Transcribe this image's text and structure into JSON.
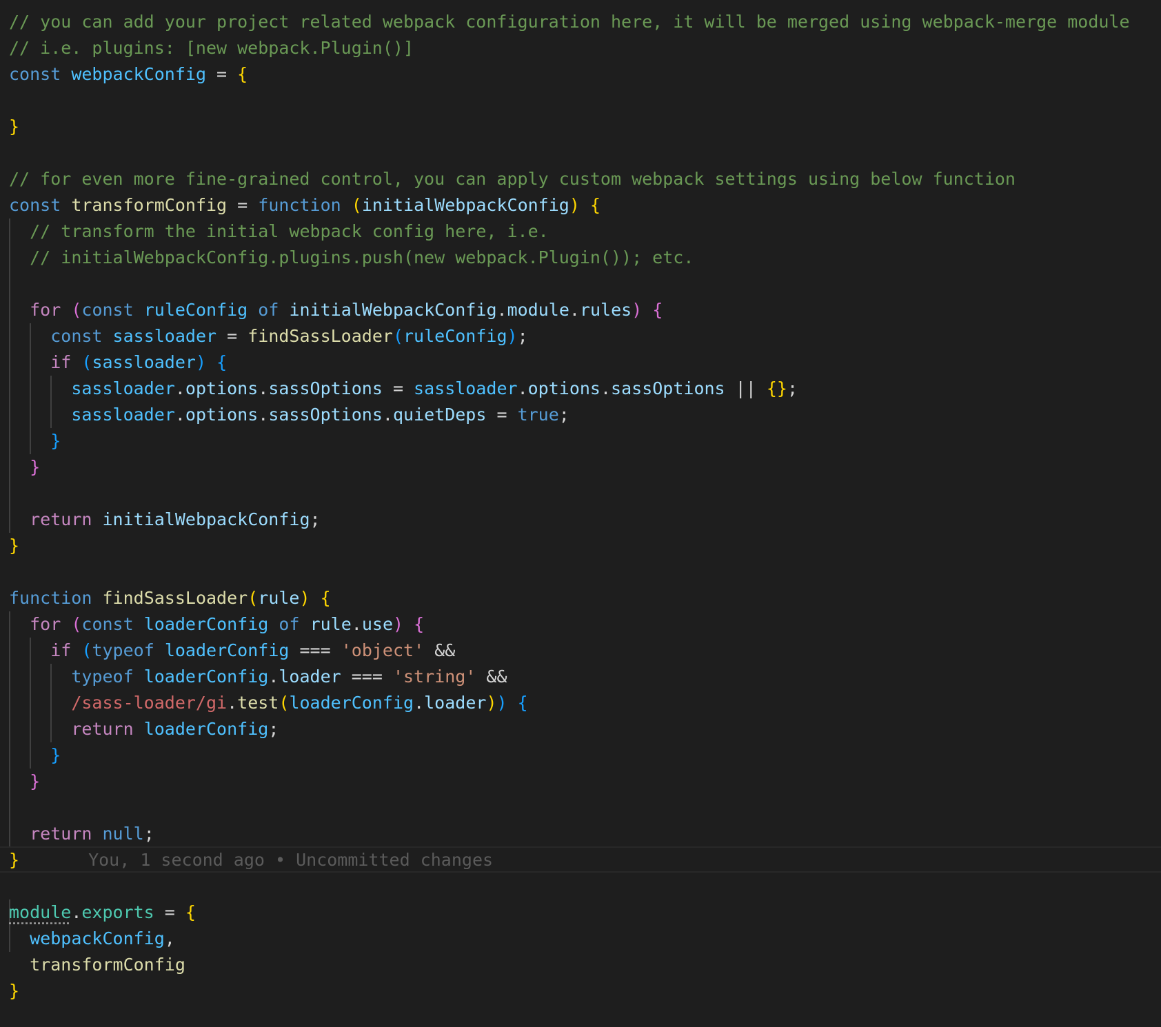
{
  "colors": {
    "background": "#1e1e1e",
    "comment": "#6a9955",
    "keyword_storage": "#569cd6",
    "keyword_control": "#c586c0",
    "variable": "#9cdcfe",
    "constant": "#4fc1ff",
    "function": "#dcdcaa",
    "string": "#ce9178",
    "regex": "#d16969",
    "operator": "#d4d4d4",
    "bracket_gold": "#ffd700",
    "bracket_pink": "#da70d6",
    "bracket_blue": "#179fff",
    "property": "#4ec9b0",
    "blame": "#5b5b5b"
  },
  "blame_annotation": "You, 1 second ago • Uncommitted changes",
  "lines": [
    [
      {
        "t": "// you can add your project related webpack configuration here, it will be merged using webpack-merge module",
        "c": "comment"
      }
    ],
    [
      {
        "t": "// i.e. plugins: [new webpack.Plugin()]",
        "c": "comment"
      }
    ],
    [
      {
        "t": "const",
        "c": "keyword_storage"
      },
      {
        "t": " ",
        "c": "operator"
      },
      {
        "t": "webpackConfig",
        "c": "constant"
      },
      {
        "t": " = ",
        "c": "operator"
      },
      {
        "t": "{",
        "c": "bracket_gold"
      }
    ],
    [],
    [
      {
        "t": "}",
        "c": "bracket_gold"
      }
    ],
    [],
    [
      {
        "t": "// for even more fine-grained control, you can apply custom webpack settings using below function",
        "c": "comment"
      }
    ],
    [
      {
        "t": "const",
        "c": "keyword_storage"
      },
      {
        "t": " ",
        "c": "operator"
      },
      {
        "t": "transformConfig",
        "c": "function"
      },
      {
        "t": " = ",
        "c": "operator"
      },
      {
        "t": "function",
        "c": "keyword_storage"
      },
      {
        "t": " ",
        "c": "operator"
      },
      {
        "t": "(",
        "c": "bracket_gold"
      },
      {
        "t": "initialWebpackConfig",
        "c": "variable"
      },
      {
        "t": ")",
        "c": "bracket_gold"
      },
      {
        "t": " ",
        "c": "operator"
      },
      {
        "t": "{",
        "c": "bracket_gold"
      }
    ],
    [
      {
        "t": "  ",
        "c": "operator"
      },
      {
        "t": "// transform the initial webpack config here, i.e.",
        "c": "comment"
      }
    ],
    [
      {
        "t": "  ",
        "c": "operator"
      },
      {
        "t": "// initialWebpackConfig.plugins.push(new webpack.Plugin()); etc.",
        "c": "comment"
      }
    ],
    [],
    [
      {
        "t": "  ",
        "c": "operator"
      },
      {
        "t": "for",
        "c": "keyword_control"
      },
      {
        "t": " ",
        "c": "operator"
      },
      {
        "t": "(",
        "c": "bracket_pink"
      },
      {
        "t": "const",
        "c": "keyword_storage"
      },
      {
        "t": " ",
        "c": "operator"
      },
      {
        "t": "ruleConfig",
        "c": "constant"
      },
      {
        "t": " ",
        "c": "operator"
      },
      {
        "t": "of",
        "c": "keyword_storage"
      },
      {
        "t": " ",
        "c": "operator"
      },
      {
        "t": "initialWebpackConfig",
        "c": "variable"
      },
      {
        "t": ".",
        "c": "operator"
      },
      {
        "t": "module",
        "c": "variable"
      },
      {
        "t": ".",
        "c": "operator"
      },
      {
        "t": "rules",
        "c": "variable"
      },
      {
        "t": ")",
        "c": "bracket_pink"
      },
      {
        "t": " ",
        "c": "operator"
      },
      {
        "t": "{",
        "c": "bracket_pink"
      }
    ],
    [
      {
        "t": "    ",
        "c": "operator"
      },
      {
        "t": "const",
        "c": "keyword_storage"
      },
      {
        "t": " ",
        "c": "operator"
      },
      {
        "t": "sassloader",
        "c": "constant"
      },
      {
        "t": " = ",
        "c": "operator"
      },
      {
        "t": "findSassLoader",
        "c": "function"
      },
      {
        "t": "(",
        "c": "bracket_blue"
      },
      {
        "t": "ruleConfig",
        "c": "constant"
      },
      {
        "t": ")",
        "c": "bracket_blue"
      },
      {
        "t": ";",
        "c": "operator"
      }
    ],
    [
      {
        "t": "    ",
        "c": "operator"
      },
      {
        "t": "if",
        "c": "keyword_control"
      },
      {
        "t": " ",
        "c": "operator"
      },
      {
        "t": "(",
        "c": "bracket_blue"
      },
      {
        "t": "sassloader",
        "c": "constant"
      },
      {
        "t": ")",
        "c": "bracket_blue"
      },
      {
        "t": " ",
        "c": "operator"
      },
      {
        "t": "{",
        "c": "bracket_blue"
      }
    ],
    [
      {
        "t": "      ",
        "c": "operator"
      },
      {
        "t": "sassloader",
        "c": "constant"
      },
      {
        "t": ".",
        "c": "operator"
      },
      {
        "t": "options",
        "c": "variable"
      },
      {
        "t": ".",
        "c": "operator"
      },
      {
        "t": "sassOptions",
        "c": "variable"
      },
      {
        "t": " = ",
        "c": "operator"
      },
      {
        "t": "sassloader",
        "c": "constant"
      },
      {
        "t": ".",
        "c": "operator"
      },
      {
        "t": "options",
        "c": "variable"
      },
      {
        "t": ".",
        "c": "operator"
      },
      {
        "t": "sassOptions",
        "c": "variable"
      },
      {
        "t": " || ",
        "c": "operator"
      },
      {
        "t": "{}",
        "c": "bracket_gold"
      },
      {
        "t": ";",
        "c": "operator"
      }
    ],
    [
      {
        "t": "      ",
        "c": "operator"
      },
      {
        "t": "sassloader",
        "c": "constant"
      },
      {
        "t": ".",
        "c": "operator"
      },
      {
        "t": "options",
        "c": "variable"
      },
      {
        "t": ".",
        "c": "operator"
      },
      {
        "t": "sassOptions",
        "c": "variable"
      },
      {
        "t": ".",
        "c": "operator"
      },
      {
        "t": "quietDeps",
        "c": "variable"
      },
      {
        "t": " = ",
        "c": "operator"
      },
      {
        "t": "true",
        "c": "keyword_storage"
      },
      {
        "t": ";",
        "c": "operator"
      }
    ],
    [
      {
        "t": "    ",
        "c": "operator"
      },
      {
        "t": "}",
        "c": "bracket_blue"
      }
    ],
    [
      {
        "t": "  ",
        "c": "operator"
      },
      {
        "t": "}",
        "c": "bracket_pink"
      }
    ],
    [],
    [
      {
        "t": "  ",
        "c": "operator"
      },
      {
        "t": "return",
        "c": "keyword_control"
      },
      {
        "t": " ",
        "c": "operator"
      },
      {
        "t": "initialWebpackConfig",
        "c": "variable"
      },
      {
        "t": ";",
        "c": "operator"
      }
    ],
    [
      {
        "t": "}",
        "c": "bracket_gold"
      }
    ],
    [],
    [
      {
        "t": "function",
        "c": "keyword_storage"
      },
      {
        "t": " ",
        "c": "operator"
      },
      {
        "t": "findSassLoader",
        "c": "function"
      },
      {
        "t": "(",
        "c": "bracket_gold"
      },
      {
        "t": "rule",
        "c": "variable"
      },
      {
        "t": ")",
        "c": "bracket_gold"
      },
      {
        "t": " ",
        "c": "operator"
      },
      {
        "t": "{",
        "c": "bracket_gold"
      }
    ],
    [
      {
        "t": "  ",
        "c": "operator"
      },
      {
        "t": "for",
        "c": "keyword_control"
      },
      {
        "t": " ",
        "c": "operator"
      },
      {
        "t": "(",
        "c": "bracket_pink"
      },
      {
        "t": "const",
        "c": "keyword_storage"
      },
      {
        "t": " ",
        "c": "operator"
      },
      {
        "t": "loaderConfig",
        "c": "constant"
      },
      {
        "t": " ",
        "c": "operator"
      },
      {
        "t": "of",
        "c": "keyword_storage"
      },
      {
        "t": " ",
        "c": "operator"
      },
      {
        "t": "rule",
        "c": "variable"
      },
      {
        "t": ".",
        "c": "operator"
      },
      {
        "t": "use",
        "c": "variable"
      },
      {
        "t": ")",
        "c": "bracket_pink"
      },
      {
        "t": " ",
        "c": "operator"
      },
      {
        "t": "{",
        "c": "bracket_pink"
      }
    ],
    [
      {
        "t": "    ",
        "c": "operator"
      },
      {
        "t": "if",
        "c": "keyword_control"
      },
      {
        "t": " ",
        "c": "operator"
      },
      {
        "t": "(",
        "c": "bracket_blue"
      },
      {
        "t": "typeof",
        "c": "keyword_storage"
      },
      {
        "t": " ",
        "c": "operator"
      },
      {
        "t": "loaderConfig",
        "c": "constant"
      },
      {
        "t": " === ",
        "c": "operator"
      },
      {
        "t": "'object'",
        "c": "string"
      },
      {
        "t": " &&",
        "c": "operator"
      }
    ],
    [
      {
        "t": "      ",
        "c": "operator"
      },
      {
        "t": "typeof",
        "c": "keyword_storage"
      },
      {
        "t": " ",
        "c": "operator"
      },
      {
        "t": "loaderConfig",
        "c": "constant"
      },
      {
        "t": ".",
        "c": "operator"
      },
      {
        "t": "loader",
        "c": "variable"
      },
      {
        "t": " === ",
        "c": "operator"
      },
      {
        "t": "'string'",
        "c": "string"
      },
      {
        "t": " &&",
        "c": "operator"
      }
    ],
    [
      {
        "t": "      ",
        "c": "operator"
      },
      {
        "t": "/sass-loader/gi",
        "c": "regex"
      },
      {
        "t": ".",
        "c": "operator"
      },
      {
        "t": "test",
        "c": "function"
      },
      {
        "t": "(",
        "c": "bracket_gold"
      },
      {
        "t": "loaderConfig",
        "c": "constant"
      },
      {
        "t": ".",
        "c": "operator"
      },
      {
        "t": "loader",
        "c": "variable"
      },
      {
        "t": ")",
        "c": "bracket_gold"
      },
      {
        "t": ")",
        "c": "bracket_blue"
      },
      {
        "t": " ",
        "c": "operator"
      },
      {
        "t": "{",
        "c": "bracket_blue"
      }
    ],
    [
      {
        "t": "      ",
        "c": "operator"
      },
      {
        "t": "return",
        "c": "keyword_control"
      },
      {
        "t": " ",
        "c": "operator"
      },
      {
        "t": "loaderConfig",
        "c": "constant"
      },
      {
        "t": ";",
        "c": "operator"
      }
    ],
    [
      {
        "t": "    ",
        "c": "operator"
      },
      {
        "t": "}",
        "c": "bracket_blue"
      }
    ],
    [
      {
        "t": "  ",
        "c": "operator"
      },
      {
        "t": "}",
        "c": "bracket_pink"
      }
    ],
    [],
    [
      {
        "t": "  ",
        "c": "operator"
      },
      {
        "t": "return",
        "c": "keyword_control"
      },
      {
        "t": " ",
        "c": "operator"
      },
      {
        "t": "null",
        "c": "keyword_storage"
      },
      {
        "t": ";",
        "c": "operator"
      }
    ],
    [
      {
        "t": "}",
        "c": "bracket_gold"
      }
    ],
    [],
    [
      {
        "t": "module",
        "c": "property",
        "u": true
      },
      {
        "t": ".",
        "c": "operator"
      },
      {
        "t": "exports",
        "c": "property"
      },
      {
        "t": " = ",
        "c": "operator"
      },
      {
        "t": "{",
        "c": "bracket_gold"
      }
    ],
    [
      {
        "t": "  ",
        "c": "operator"
      },
      {
        "t": "webpackConfig",
        "c": "constant"
      },
      {
        "t": ",",
        "c": "operator"
      }
    ],
    [
      {
        "t": "  ",
        "c": "operator"
      },
      {
        "t": "transformConfig",
        "c": "function"
      }
    ],
    [
      {
        "t": "}",
        "c": "bracket_gold"
      }
    ]
  ]
}
